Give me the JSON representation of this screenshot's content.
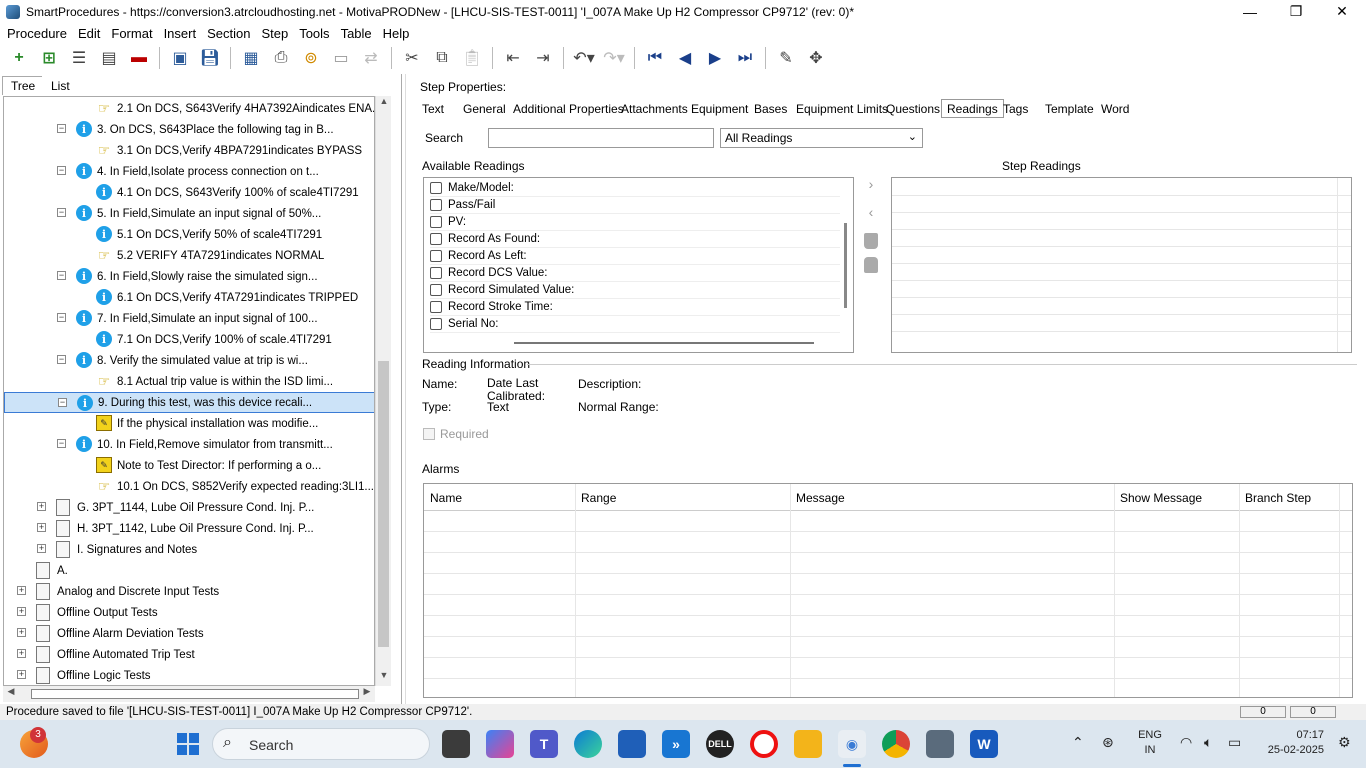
{
  "window": {
    "title": "SmartProcedures - https://conversion3.atrcloudhosting.net - MotivaPRODNew - [LHCU-SIS-TEST-0011] 'I_007A Make Up H2 Compressor CP9712' (rev: 0)*",
    "minimize": "—",
    "maximize": "❐",
    "close": "✕"
  },
  "menu": [
    "Procedure",
    "Edit",
    "Format",
    "Insert",
    "Section",
    "Step",
    "Tools",
    "Table",
    "Help"
  ],
  "left_tabs": {
    "tree": "Tree",
    "list": "List"
  },
  "tree_rows": [
    {
      "label": "2.1 On DCS, S643Verify 4HA7392Aindicates ENA...",
      "icon": "hand",
      "indent": 2,
      "exp": ""
    },
    {
      "label": "3. On DCS, S643Place the following tag in B...",
      "icon": "info",
      "indent": 1,
      "exp": "−"
    },
    {
      "label": "3.1 On DCS,Verify 4BPA7291indicates BYPASS",
      "icon": "hand",
      "indent": 2,
      "exp": ""
    },
    {
      "label": "4. In Field,Isolate process connection on t...",
      "icon": "info",
      "indent": 1,
      "exp": "−"
    },
    {
      "label": "4.1 On DCS, S643Verify 100% of scale4TI7291",
      "icon": "info",
      "indent": 2,
      "exp": ""
    },
    {
      "label": "5. In Field,Simulate an input signal of 50%...",
      "icon": "info",
      "indent": 1,
      "exp": "−"
    },
    {
      "label": "5.1 On DCS,Verify 50% of scale4TI7291",
      "icon": "info",
      "indent": 2,
      "exp": ""
    },
    {
      "label": "5.2 VERIFY 4TA7291indicates NORMAL",
      "icon": "hand",
      "indent": 2,
      "exp": ""
    },
    {
      "label": "6. In Field,Slowly raise the simulated sign...",
      "icon": "info",
      "indent": 1,
      "exp": "−"
    },
    {
      "label": "6.1 On DCS,Verify 4TA7291indicates TRIPPED",
      "icon": "info",
      "indent": 2,
      "exp": ""
    },
    {
      "label": "7. In Field,Simulate an input signal of 100...",
      "icon": "info",
      "indent": 1,
      "exp": "−"
    },
    {
      "label": "7.1 On DCS,Verify 100% of scale.4TI7291",
      "icon": "info",
      "indent": 2,
      "exp": ""
    },
    {
      "label": "8. Verify the simulated value at trip is wi...",
      "icon": "info",
      "indent": 1,
      "exp": "−"
    },
    {
      "label": "8.1 Actual trip value is within the ISD limi...",
      "icon": "hand",
      "indent": 2,
      "exp": ""
    },
    {
      "label": "9. During this test, was this device recali...",
      "icon": "info",
      "indent": 1,
      "exp": "−",
      "selected": true
    },
    {
      "label": "If the physical installation was modifie...",
      "icon": "note",
      "indent": 2,
      "exp": ""
    },
    {
      "label": "10. In Field,Remove simulator from transmitt...",
      "icon": "info",
      "indent": 1,
      "exp": "−"
    },
    {
      "label": "Note to Test Director: If performing a o...",
      "icon": "note",
      "indent": 2,
      "exp": ""
    },
    {
      "label": "10.1 On DCS, S852Verify expected reading:3LI1...",
      "icon": "hand",
      "indent": 2,
      "exp": ""
    },
    {
      "label": "G. 3PT_1144, Lube Oil Pressure Cond. Inj. P...",
      "icon": "page",
      "indent": 0.5,
      "exp": "+"
    },
    {
      "label": "H. 3PT_1142, Lube Oil Pressure Cond. Inj. P...",
      "icon": "page",
      "indent": 0.5,
      "exp": "+"
    },
    {
      "label": "I. Signatures and Notes",
      "icon": "page",
      "indent": 0.5,
      "exp": "+"
    },
    {
      "label": "A.",
      "icon": "page",
      "indent": 0,
      "exp": ""
    },
    {
      "label": "Analog and Discrete Input Tests",
      "icon": "page",
      "indent": 0,
      "exp": "+"
    },
    {
      "label": "Offline Output Tests",
      "icon": "page",
      "indent": 0,
      "exp": "+"
    },
    {
      "label": "Offline Alarm Deviation Tests",
      "icon": "page",
      "indent": 0,
      "exp": "+"
    },
    {
      "label": "Offline Automated Trip Test",
      "icon": "page",
      "indent": 0,
      "exp": "+"
    },
    {
      "label": "Offline Logic Tests",
      "icon": "page",
      "indent": 0,
      "exp": "+"
    }
  ],
  "step_props": {
    "heading": "Step Properties:",
    "tabs": [
      "Text",
      "General",
      "Additional Properties",
      "Attachments",
      "Equipment",
      "Bases",
      "Equipment Limits",
      "Questions",
      "Readings",
      "Tags",
      "Template",
      "Word"
    ],
    "active_tab": "Readings",
    "search_label": "Search",
    "search_value": "",
    "filter_value": "All Readings",
    "available_label": "Available Readings",
    "step_readings_label": "Step Readings",
    "readings": [
      "Make/Model:",
      "Pass/Fail",
      "PV:",
      "Record As Found:",
      "Record As Left:",
      "Record DCS Value:",
      "Record Simulated Value:",
      "Record Stroke Time:",
      "Serial No:"
    ],
    "move_right": "›",
    "move_left": "‹",
    "reading_info_label": "Reading Information",
    "name_label": "Name:",
    "type_label": "Type:",
    "type_value": "Text",
    "date_label_1": "Date Last",
    "date_label_2": "Calibrated:",
    "desc_label": "Description:",
    "range_label": "Normal Range:",
    "required_label": "Required",
    "alarms_label": "Alarms",
    "alarm_columns": [
      "Name",
      "Range",
      "Message",
      "Show Message",
      "Branch Step"
    ]
  },
  "status": {
    "message": "Procedure saved to file '[LHCU-SIS-TEST-0011] I_007A Make Up H2 Compressor CP9712'.",
    "field1": "0",
    "field2": "0"
  },
  "taskbar": {
    "search_label": "Search",
    "badge_count": "3",
    "lang_1": "ENG",
    "lang_2": "IN",
    "time": "07:17",
    "date": "25-02-2025"
  }
}
